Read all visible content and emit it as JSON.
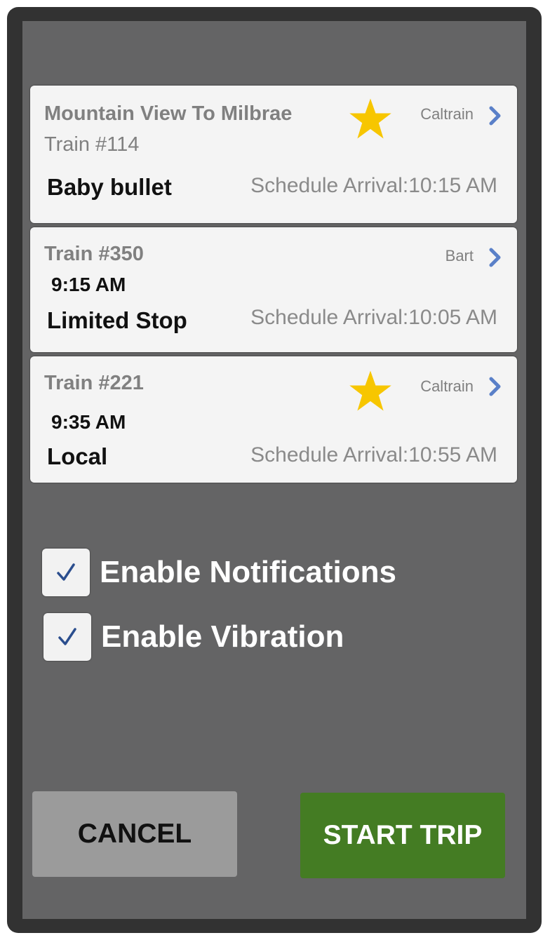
{
  "trips": [
    {
      "route": "Mountain View To Milbrae",
      "train": "Train #114",
      "departure": "",
      "service": "Baby bullet",
      "arrival": "Schedule Arrival:10:15 AM",
      "operator": "Caltrain",
      "favorite": true
    },
    {
      "route": "",
      "train": "Train #350",
      "departure": "9:15 AM",
      "service": "Limited Stop",
      "arrival": "Schedule Arrival:10:05 AM",
      "operator": "Bart",
      "favorite": false
    },
    {
      "route": "",
      "train": "Train #221",
      "departure": "9:35 AM",
      "service": "Local",
      "arrival": "Schedule Arrival:10:55 AM",
      "operator": "Caltrain",
      "favorite": true
    }
  ],
  "options": {
    "notifications": {
      "label": "Enable Notifications",
      "checked": true
    },
    "vibration": {
      "label": "Enable Vibration",
      "checked": true
    }
  },
  "buttons": {
    "cancel": "CANCEL",
    "start": "START TRIP"
  },
  "icons": {
    "star": "star-icon",
    "chevron": "chevron-right-icon",
    "check": "checkmark-icon"
  },
  "colors": {
    "star": "#f7c600",
    "chevron": "#5a80c8",
    "check": "#2b4e8e",
    "start_button": "#447c23",
    "cancel_button": "#9b9b9b",
    "background": "#646465"
  }
}
